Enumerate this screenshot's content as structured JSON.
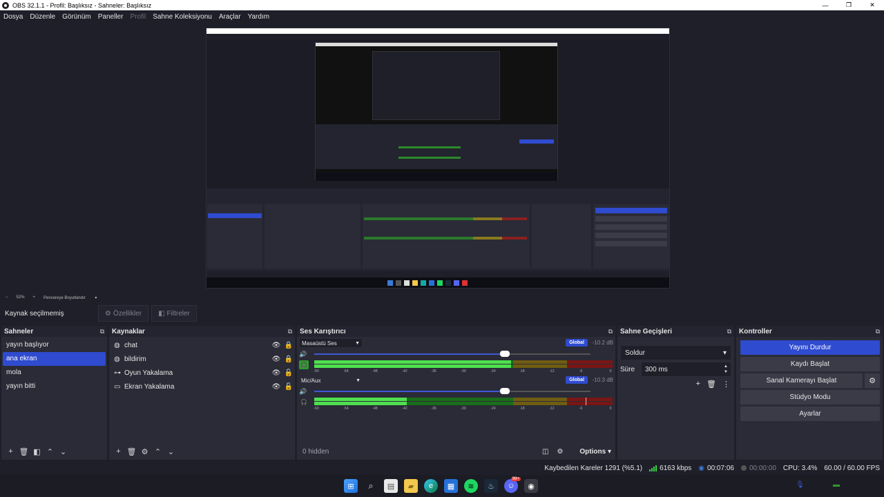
{
  "window": {
    "title": "OBS 32.1.1 - Profil: Başlıksız - Sahneler: Başlıksız",
    "minimize": "—",
    "maximize": "❐",
    "close": "✕"
  },
  "menu": [
    "Dosya",
    "Düzenle",
    "Görünüm",
    "Paneller",
    "Profil",
    "Sahne Koleksiyonu",
    "Araçlar",
    "Yardım"
  ],
  "preview": {
    "zoom": "52%",
    "fit_label": "Pencereye Boyutlandır"
  },
  "context": {
    "no_source": "Kaynak seçilmemiş",
    "properties": "Özellikler",
    "filters": "Filtreler"
  },
  "scenes": {
    "title": "Sahneler",
    "items": [
      "yayın başlıyor",
      "ana ekran",
      "mola",
      "yayın bitti"
    ],
    "active_index": 1
  },
  "sources": {
    "title": "Kaynaklar",
    "items": [
      {
        "name": "chat",
        "icon": "globe-icon",
        "locked": true
      },
      {
        "name": "bildirim",
        "icon": "globe-icon",
        "locked": true
      },
      {
        "name": "Oyun Yakalama",
        "icon": "gamepad-icon",
        "locked": false
      },
      {
        "name": "Ekran Yakalama",
        "icon": "monitor-icon",
        "locked": false
      }
    ]
  },
  "mixer": {
    "title": "Ses Karıştırıcı",
    "channels": [
      {
        "name": "Masaüstü Ses",
        "db": "-10.2 dB",
        "badge": "Global",
        "volume": 0.69,
        "level": 0.66,
        "peak": null,
        "monitor": true
      },
      {
        "name": "Mic/Aux",
        "db": "-10.3 dB",
        "badge": "Global",
        "volume": 0.69,
        "level": 0.31,
        "peak": 0.91,
        "monitor": false
      }
    ],
    "ticks": [
      "-60",
      "-54",
      "-48",
      "-42",
      "-36",
      "-30",
      "-24",
      "-18",
      "-12",
      "-6",
      "0"
    ],
    "hidden": "0 hidden",
    "options": "Options"
  },
  "transitions": {
    "title": "Sahne Geçişleri",
    "selected": "Soldur",
    "duration_label": "Süre",
    "duration_value": "300 ms"
  },
  "controls": {
    "title": "Kontroller",
    "stop_stream": "Yayını Durdur",
    "start_record": "Kaydı Başlat",
    "start_vcam": "Sanal Kamerayı Başlat",
    "studio_mode": "Stüdyo Modu",
    "settings": "Ayarlar"
  },
  "status": {
    "dropped": "Kaybedilen Kareler 1291 (%5.1)",
    "bitrate": "6163 kbps",
    "stream_time": "00:07:06",
    "rec_time": "00:00:00",
    "cpu": "CPU: 3.4%",
    "fps": "60.00 / 60.00 FPS"
  },
  "taskbar": {
    "discord_badge": "99+"
  },
  "colors": {
    "accent": "#2f4bcf",
    "meter_green": "#4fe04f",
    "background": "#1e1f29",
    "panel": "#2a2b36"
  }
}
